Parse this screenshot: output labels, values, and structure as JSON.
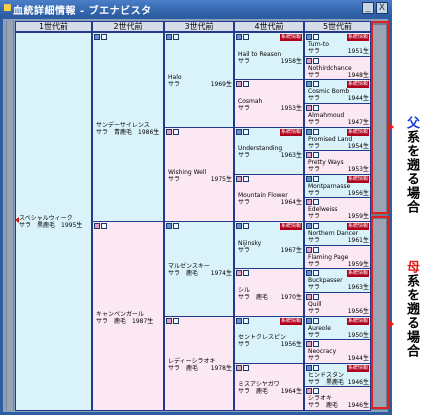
{
  "window": {
    "title": "血統詳細情報 - ブエナビスタ",
    "title_icon": "app-icon",
    "minimize": "_",
    "close": "X"
  },
  "columns": [
    "1世代前",
    "2世代前",
    "3世代前",
    "4世代前",
    "5世代前"
  ],
  "badge_label": "系統情報",
  "sex_label_mare": "サラ",
  "gen1": [
    {
      "name": "スペシャルウィーク",
      "detail": "サラ　黒鹿毛　1995生",
      "sex": "male"
    }
  ],
  "gen2": [
    {
      "name": "サンデーサイレンス",
      "detail": "サラ　青鹿毛　1986生",
      "sex": "male"
    },
    {
      "name": "キャンペンガール",
      "detail": "サラ　鹿毛　1987生",
      "sex": "female"
    }
  ],
  "gen3": [
    {
      "name": "Halo",
      "detail": "サラ",
      "year": "1969生",
      "sex": "male"
    },
    {
      "name": "Wishing Well",
      "detail": "サラ",
      "year": "1975生",
      "sex": "female"
    },
    {
      "name": "マルゼンスキー",
      "detail": "サラ　鹿毛",
      "year": "1974生",
      "sex": "male"
    },
    {
      "name": "レディーシラオキ",
      "detail": "サラ　鹿毛",
      "year": "1978生",
      "sex": "female"
    }
  ],
  "gen4": [
    {
      "name": "Hail to Reason",
      "detail": "サラ",
      "year": "1958生",
      "sex": "male"
    },
    {
      "name": "Cosmah",
      "detail": "サラ",
      "year": "1953生",
      "sex": "female"
    },
    {
      "name": "Understanding",
      "detail": "サラ",
      "year": "1963生",
      "sex": "male"
    },
    {
      "name": "Mountain Flower",
      "detail": "サラ",
      "year": "1964生",
      "sex": "female"
    },
    {
      "name": "Nijinsky",
      "detail": "サラ",
      "year": "1967生",
      "sex": "male"
    },
    {
      "name": "シル",
      "detail": "サラ　鹿毛",
      "year": "1970生",
      "sex": "female"
    },
    {
      "name": "セントクレスピン",
      "detail": "サラ",
      "year": "1956生",
      "sex": "male"
    },
    {
      "name": "ミスアシヤガワ",
      "detail": "サラ　鹿毛",
      "year": "1964生",
      "sex": "female"
    }
  ],
  "gen5": [
    {
      "name": "Turn-to",
      "detail": "サラ",
      "year": "1951生",
      "sex": "male"
    },
    {
      "name": "Nothirdchance",
      "detail": "サラ",
      "year": "1948生",
      "sex": "female"
    },
    {
      "name": "Cosmic Bomb",
      "detail": "サラ",
      "year": "1944生",
      "sex": "male"
    },
    {
      "name": "Almahmoud",
      "detail": "サラ",
      "year": "1947生",
      "sex": "female"
    },
    {
      "name": "Promised Land",
      "detail": "サラ",
      "year": "1954生",
      "sex": "male"
    },
    {
      "name": "Pretty Ways",
      "detail": "サラ",
      "year": "1953生",
      "sex": "female"
    },
    {
      "name": "Montparnasse",
      "detail": "サラ",
      "year": "1956生",
      "sex": "male"
    },
    {
      "name": "Edelweiss",
      "detail": "サラ",
      "year": "1959生",
      "sex": "female"
    },
    {
      "name": "Northern Dancer",
      "detail": "サラ",
      "year": "1961生",
      "sex": "male"
    },
    {
      "name": "Flaming Page",
      "detail": "サラ",
      "year": "1959生",
      "sex": "female"
    },
    {
      "name": "Buckpasser",
      "detail": "サラ",
      "year": "1963生",
      "sex": "male"
    },
    {
      "name": "Quill",
      "detail": "サラ",
      "year": "1956生",
      "sex": "female"
    },
    {
      "name": "Aureole",
      "detail": "サラ",
      "year": "1950生",
      "sex": "male"
    },
    {
      "name": "Neocracy",
      "detail": "サラ",
      "year": "1944生",
      "sex": "female"
    },
    {
      "name": "ヒンドスタン",
      "detail": "サラ　黒鹿毛",
      "year": "1946生",
      "sex": "male"
    },
    {
      "name": "シラオキ",
      "detail": "サラ　鹿毛",
      "year": "1946生",
      "sex": "female"
    }
  ],
  "annotations": {
    "paternal_a": "父",
    "paternal_b": "系を遡る場合",
    "maternal_a": "母",
    "maternal_b": "系を遡る場合"
  },
  "colors": {
    "window_blue": "#2d5fa0",
    "male_cell": "#daf3fb",
    "female_cell": "#fce8f3",
    "badge_red": "#b0001c",
    "highlight_red": "#e0201c",
    "highlight_blue": "#1a3ad8"
  }
}
